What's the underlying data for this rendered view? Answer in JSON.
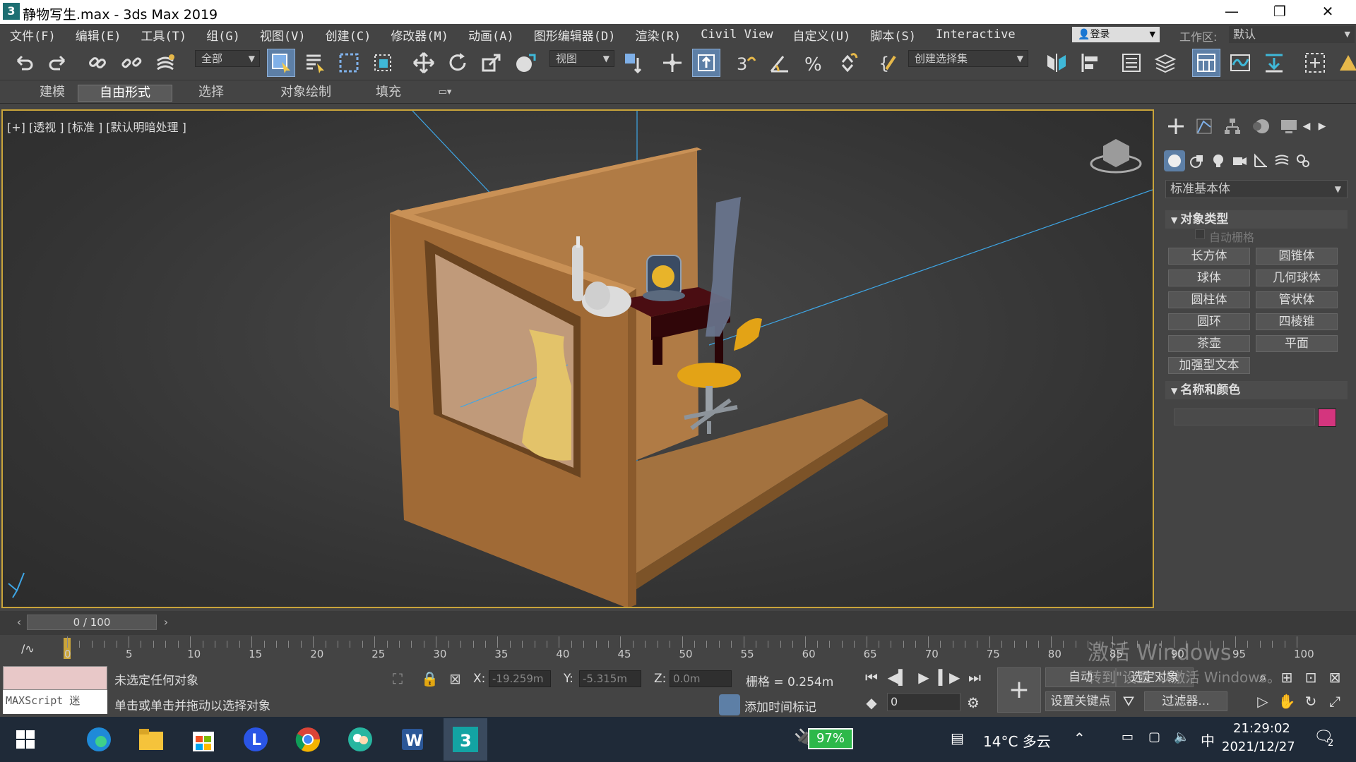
{
  "window": {
    "title": "静物写生.max - 3ds Max 2019",
    "app_icon": "3"
  },
  "menu": [
    "文件(F)",
    "编辑(E)",
    "工具(T)",
    "组(G)",
    "视图(V)",
    "创建(C)",
    "修改器(M)",
    "动画(A)",
    "图形编辑器(D)",
    "渲染(R)",
    "Civil View",
    "自定义(U)",
    "脚本(S)",
    "Interactive"
  ],
  "login": "登录",
  "workspace": {
    "label": "工作区:",
    "value": "默认"
  },
  "toolbar": {
    "filter": "全部",
    "coord_system": "视图",
    "selection_set": "创建选择集",
    "snap_label": "3"
  },
  "ribbon": {
    "tabs": [
      "建模",
      "自由形式",
      "选择",
      "对象绘制",
      "填充"
    ],
    "active": "自由形式"
  },
  "viewport": {
    "label": "[+] [透视 ] [标准 ] [默认明暗处理 ]"
  },
  "command_panel": {
    "category": "标准基本体",
    "object_type_title": "对象类型",
    "auto_grid": "自动栅格",
    "buttons": [
      "长方体",
      "圆锥体",
      "球体",
      "几何球体",
      "圆柱体",
      "管状体",
      "圆环",
      "四棱锥",
      "茶壶",
      "平面",
      "加强型文本"
    ],
    "name_color_title": "名称和颜色",
    "swatch_color": "#d4357e"
  },
  "timeline": {
    "frame_display": "0 / 100",
    "ticks": [
      "0",
      "5",
      "10",
      "15",
      "20",
      "25",
      "30",
      "35",
      "40",
      "45",
      "50",
      "55",
      "60",
      "65",
      "70",
      "75",
      "80",
      "85",
      "90",
      "95",
      "100"
    ]
  },
  "status": {
    "maxscript": "MAXScript 迷",
    "line1": "未选定任何对象",
    "line2": "单击或单击并拖动以选择对象",
    "x_label": "X:",
    "x_value": "-19.259m",
    "y_label": "Y:",
    "y_value": "-5.315m",
    "z_label": "Z:",
    "z_value": "0.0m",
    "grid": "栅格 = 0.254m",
    "add_time_tag": "添加时间标记",
    "auto": "自动",
    "selected_obj": "选定对象",
    "set_key": "设置关键点",
    "filter": "过滤器...",
    "frame_input": "0"
  },
  "watermark": {
    "line1": "激活 Windows",
    "line2": "转到\"设置\"以激活 Windows。"
  },
  "taskbar": {
    "battery": "97%",
    "weather": "14°C 多云",
    "ime": "中",
    "time": "21:29:02",
    "date": "2021/12/27",
    "notifications": "2"
  }
}
